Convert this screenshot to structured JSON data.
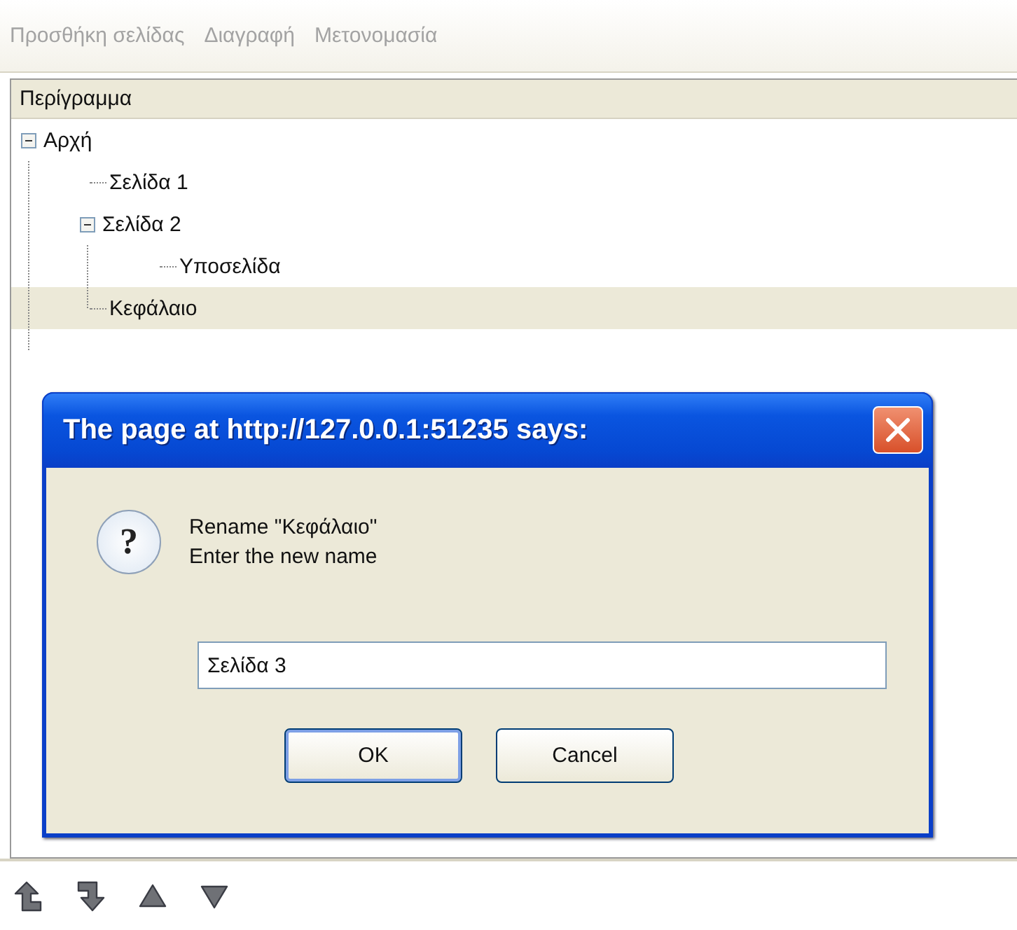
{
  "toolbar": [
    {
      "label": "Προσθήκη σελίδας",
      "disabled": true
    },
    {
      "label": "Διαγραφή",
      "disabled": true
    },
    {
      "label": "Μετονομασία",
      "disabled": true
    }
  ],
  "outline": {
    "header": "Περίγραμμα",
    "tree": [
      {
        "label": "Αρχή",
        "expanded": true,
        "selected": false,
        "children": [
          {
            "label": "Σελίδα 1",
            "selected": false
          },
          {
            "label": "Σελίδα 2",
            "expanded": true,
            "selected": false,
            "children": [
              {
                "label": "Υποσελίδα",
                "selected": false
              }
            ]
          },
          {
            "label": "Κεφάλαιο",
            "selected": true
          }
        ]
      }
    ]
  },
  "dialog": {
    "title": "The page at http://127.0.0.1:51235 says:",
    "icon_glyph": "?",
    "message_lines": [
      "Rename \"Κεφάλαιο\"",
      "Enter the new name"
    ],
    "value": "Σελίδα 3",
    "buttons": [
      {
        "label": "OK",
        "default": true
      },
      {
        "label": "Cancel",
        "default": false
      }
    ]
  },
  "bottom_toolbar": [
    {
      "kind": "promote"
    },
    {
      "kind": "demote"
    },
    {
      "kind": "up"
    },
    {
      "kind": "down"
    }
  ]
}
